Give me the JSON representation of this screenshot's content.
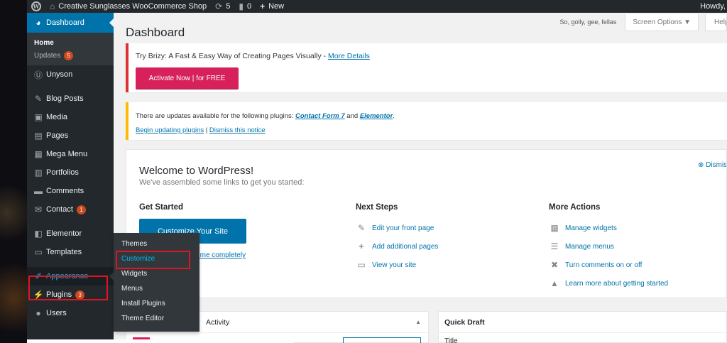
{
  "adminbar": {
    "site_name": "Creative Sunglasses WooCommerce Shop",
    "updates_count": "5",
    "comments_count": "0",
    "new_label": "New",
    "howdy": "Howdy,"
  },
  "sidebar": {
    "dashboard": "Dashboard",
    "home": "Home",
    "updates": "Updates",
    "updates_badge": "5",
    "unyson": "Unyson",
    "blog_posts": "Blog Posts",
    "media": "Media",
    "pages": "Pages",
    "mega_menu": "Mega Menu",
    "portfolios": "Portfolios",
    "comments": "Comments",
    "contact": "Contact",
    "contact_badge": "1",
    "elementor": "Elementor",
    "templates": "Templates",
    "appearance": "Appearance",
    "plugins": "Plugins",
    "plugins_badge": "3",
    "users": "Users"
  },
  "flyout": [
    "Themes",
    "Customize",
    "Widgets",
    "Menus",
    "Install Plugins",
    "Theme Editor"
  ],
  "header": {
    "title": "Dashboard",
    "motto": "So, golly, gee, fellas",
    "screen_options": "Screen Options ▼",
    "help": "Help"
  },
  "brizy": {
    "text": "Try Brizy: A Fast & Easy Way of Creating Pages Visually - ",
    "link": "More Details",
    "button": "Activate Now | for FREE"
  },
  "plugin_updates": {
    "text": "There are updates available for the following plugins: ",
    "plugin1": "Contact Form 7",
    "and": " and ",
    "plugin2": "Elementor",
    "period": ".",
    "begin": "Begin updating plugins",
    "pipe": " | ",
    "dismiss": "Dismiss this notice"
  },
  "welcome": {
    "title": "Welcome to WordPress!",
    "subtitle": "We've assembled some links to get you started:",
    "dismiss": "Dismiss",
    "get_started": "Get Started",
    "customize_button": "Customize Your Site",
    "or_change": "or, change your theme completely",
    "next_steps": "Next Steps",
    "next_items": [
      "Edit your front page",
      "Add additional pages",
      "View your site"
    ],
    "more_actions": "More Actions",
    "more_items": [
      "Manage widgets",
      "Manage menus",
      "Turn comments on or off",
      "Learn more about getting started"
    ]
  },
  "boxes": {
    "left_title": "Activity",
    "right_title": "Quick Draft",
    "right_field": "Title"
  },
  "colors": {
    "admin_dark": "#23282d",
    "accent": "#0073aa",
    "brizy_pink": "#d6215b",
    "highlight_red": "#e2141f"
  }
}
